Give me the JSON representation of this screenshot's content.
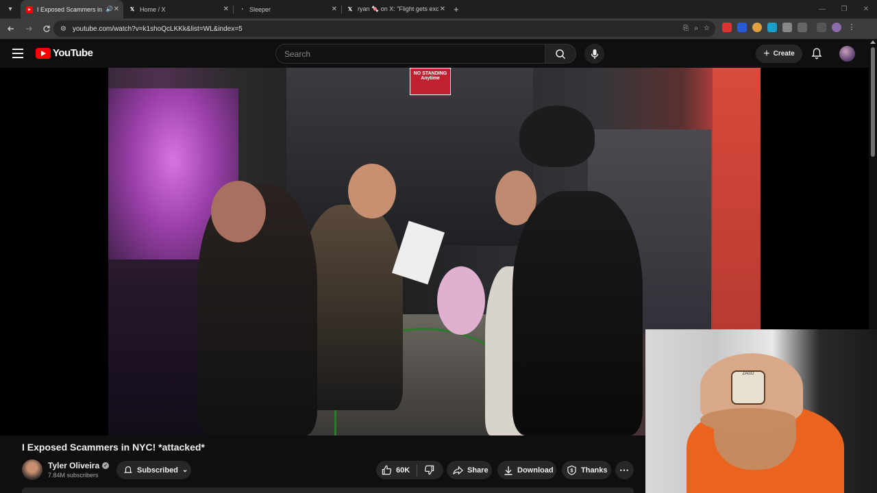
{
  "browser": {
    "tabs": [
      {
        "title": "I Exposed Scammers in NYC",
        "favicon": "youtube-icon",
        "active": true,
        "audio": true
      },
      {
        "title": "Home / X",
        "favicon": "x-icon",
        "active": false
      },
      {
        "title": "Sleeper",
        "favicon": "sleeper-icon",
        "active": false
      },
      {
        "title": "ryan 🍬 on X: \"Flight gets excit",
        "favicon": "x-icon",
        "active": false
      }
    ],
    "url": "youtube.com/watch?v=k1shoQcLKKk&list=WL&index=5"
  },
  "youtube": {
    "logo_text": "YouTube",
    "search_placeholder": "Search",
    "create_label": "Create"
  },
  "video": {
    "sign_text_1": "NO STANDING",
    "sign_text_2": "Anytime",
    "patch_text": "ZAGO",
    "title": "I Exposed Scammers in NYC! *attacked*",
    "channel_name": "Tyler Oliveira",
    "subscribers": "7.84M subscribers",
    "subscribe_label": "Subscribed",
    "likes": "60K",
    "share_label": "Share",
    "download_label": "Download",
    "thanks_label": "Thanks"
  },
  "colors": {
    "youtube_red": "#ff0000",
    "background": "#0f0f0f",
    "pill": "#272727"
  }
}
